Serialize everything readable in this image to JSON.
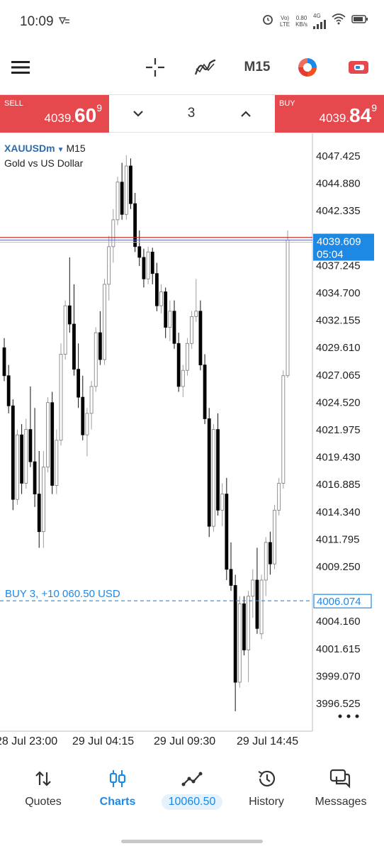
{
  "status_bar": {
    "time": "10:09",
    "notification_icon": "cast-icon",
    "network_top": "Vo)",
    "network_bottom": "LTE",
    "speed_value": "0.80",
    "speed_unit": "KB/s",
    "network_type": "4G"
  },
  "toolbar": {
    "menu_icon": "hamburger-menu-icon",
    "crosshair_icon": "crosshair-icon",
    "indicators_icon": "indicators-icon",
    "timeframe": "M15",
    "objects_icon": "color-wheel-icon",
    "trade_icon": "trade-toggle-icon"
  },
  "trade_panel": {
    "sell": {
      "label": "SELL",
      "price_main": "4039.",
      "price_big": "60",
      "price_sup": "9"
    },
    "buy": {
      "label": "BUY",
      "price_main": "4039.",
      "price_big": "84",
      "price_sup": "9"
    },
    "lot": "3"
  },
  "chart_data": {
    "type": "candlestick",
    "symbol": "XAUUSDm",
    "timeframe": "M15",
    "description": "Gold vs US Dollar",
    "y_ticks": [
      "4047.425",
      "4044.880",
      "4042.335",
      "4039.609",
      "4037.245",
      "4034.700",
      "4032.155",
      "4029.610",
      "4027.065",
      "4024.520",
      "4021.975",
      "4019.430",
      "4016.885",
      "4014.340",
      "4011.795",
      "4009.250",
      "4006.074",
      "4004.160",
      "4001.615",
      "3999.070",
      "3996.525"
    ],
    "y_range": [
      3995.2,
      4048.3
    ],
    "x_ticks": [
      "28 Jul 23:00",
      "29 Jul 04:15",
      "29 Jul 09:30",
      "29 Jul 14:45"
    ],
    "current_price": {
      "label": "4039.609",
      "timer": "05:04",
      "value": 4039.609,
      "ask": 4039.849,
      "color": "#1e88e5"
    },
    "position_line": {
      "text": "BUY 3,  +10 060.50 USD",
      "label": "4006.074",
      "value": 4006.074,
      "color": "#1e88e5"
    },
    "bull_color": "#ffffff",
    "bear_color": "#000000",
    "candles": [
      [
        4029.6,
        4030.5,
        4026.5,
        4027.0
      ],
      [
        4027.0,
        4028.0,
        4023.5,
        4024.2
      ],
      [
        4024.2,
        4024.8,
        4014.5,
        4015.5
      ],
      [
        4015.5,
        4022.0,
        4015.0,
        4021.5
      ],
      [
        4021.5,
        4022.5,
        4016.0,
        4017.0
      ],
      [
        4017.0,
        4023.0,
        4016.5,
        4022.0
      ],
      [
        4022.0,
        4026.0,
        4018.5,
        4019.0
      ],
      [
        4019.0,
        4024.0,
        4014.8,
        4016.0
      ],
      [
        4016.0,
        4020.0,
        4011.0,
        4012.5
      ],
      [
        4012.5,
        4020.0,
        4011.0,
        4018.5
      ],
      [
        4018.5,
        4025.0,
        4018.0,
        4024.5
      ],
      [
        4024.5,
        4025.5,
        4016.0,
        4016.8
      ],
      [
        4016.8,
        4022.0,
        4016.0,
        4021.0
      ],
      [
        4021.0,
        4030.0,
        4020.5,
        4029.0
      ],
      [
        4029.0,
        4034.0,
        4028.5,
        4033.5
      ],
      [
        4033.5,
        4038.0,
        4031.0,
        4031.8
      ],
      [
        4031.8,
        4035.5,
        4027.0,
        4027.6
      ],
      [
        4027.6,
        4030.0,
        4024.0,
        4025.0
      ],
      [
        4025.0,
        4027.0,
        4021.0,
        4021.5
      ],
      [
        4021.5,
        4024.0,
        4019.5,
        4023.5
      ],
      [
        4023.5,
        4026.5,
        4022.0,
        4026.0
      ],
      [
        4026.0,
        4031.5,
        4025.5,
        4031.0
      ],
      [
        4031.0,
        4033.0,
        4028.0,
        4028.5
      ],
      [
        4028.5,
        4036.0,
        4028.0,
        4035.5
      ],
      [
        4035.5,
        4040.0,
        4034.0,
        4039.0
      ],
      [
        4039.0,
        4042.5,
        4037.5,
        4041.5
      ],
      [
        4041.5,
        4045.5,
        4041.0,
        4045.0
      ],
      [
        4045.0,
        4046.8,
        4041.5,
        4042.0
      ],
      [
        4042.0,
        4047.5,
        4041.5,
        4046.5
      ],
      [
        4046.5,
        4047.2,
        4042.5,
        4043.0
      ],
      [
        4043.0,
        4044.0,
        4038.5,
        4039.0
      ],
      [
        4039.0,
        4040.5,
        4037.2,
        4038.0
      ],
      [
        4038.0,
        4038.8,
        4035.2,
        4036.0
      ],
      [
        4036.0,
        4039.0,
        4035.5,
        4038.5
      ],
      [
        4038.5,
        4038.9,
        4035.5,
        4036.5
      ],
      [
        4036.5,
        4037.5,
        4033.0,
        4033.5
      ],
      [
        4033.5,
        4035.5,
        4032.8,
        4034.8
      ],
      [
        4034.8,
        4035.2,
        4030.5,
        4031.5
      ],
      [
        4031.5,
        4034.0,
        4030.2,
        4033.0
      ],
      [
        4033.0,
        4034.0,
        4029.5,
        4030.0
      ],
      [
        4030.0,
        4031.0,
        4025.5,
        4026.0
      ],
      [
        4026.0,
        4028.0,
        4025.0,
        4027.5
      ],
      [
        4027.5,
        4030.5,
        4027.0,
        4030.0
      ],
      [
        4030.0,
        4033.0,
        4029.5,
        4032.5
      ],
      [
        4032.5,
        4036.0,
        4032.0,
        4033.0
      ],
      [
        4033.0,
        4034.0,
        4027.5,
        4028.0
      ],
      [
        4028.0,
        4029.0,
        4022.5,
        4023.0
      ],
      [
        4023.0,
        4024.0,
        4012.0,
        4013.0
      ],
      [
        4013.0,
        4022.5,
        4012.5,
        4022.0
      ],
      [
        4022.0,
        4023.5,
        4014.0,
        4014.5
      ],
      [
        4014.5,
        4017.0,
        4013.0,
        4016.0
      ],
      [
        4016.0,
        4017.5,
        4008.0,
        4009.0
      ],
      [
        4009.0,
        4011.5,
        4007.0,
        4007.5
      ],
      [
        4007.5,
        4008.5,
        3995.8,
        3998.5
      ],
      [
        3998.5,
        4006.5,
        3998.0,
        4005.8
      ],
      [
        4005.8,
        4006.5,
        4001.0,
        4001.5
      ],
      [
        4001.5,
        4007.0,
        3998.5,
        4006.5
      ],
      [
        4006.5,
        4009.0,
        4004.5,
        4008.0
      ],
      [
        4008.0,
        4011.0,
        4003.0,
        4003.5
      ],
      [
        4003.0,
        4008.5,
        4002.5,
        4008.0
      ],
      [
        4008.0,
        4012.0,
        4006.5,
        4011.5
      ],
      [
        4011.5,
        4012.5,
        4008.5,
        4009.5
      ],
      [
        4009.5,
        4015.0,
        4009.0,
        4014.5
      ],
      [
        4014.5,
        4017.5,
        4014.0,
        4017.0
      ],
      [
        4017.0,
        4027.5,
        4016.5,
        4027.0
      ],
      [
        4027.0,
        4040.5,
        4026.8,
        4039.609
      ]
    ],
    "grid": false,
    "overflow_menu_icon": "more-horizontal-icon"
  },
  "bottom_nav": {
    "items": [
      {
        "label": "Quotes",
        "icon": "arrows-updown-icon"
      },
      {
        "label": "Charts",
        "icon": "candlesticks-icon"
      },
      {
        "label": "",
        "icon": "trade-line-icon",
        "pill": "10060.50"
      },
      {
        "label": "History",
        "icon": "history-clock-icon"
      },
      {
        "label": "Messages",
        "icon": "messages-icon"
      }
    ]
  }
}
